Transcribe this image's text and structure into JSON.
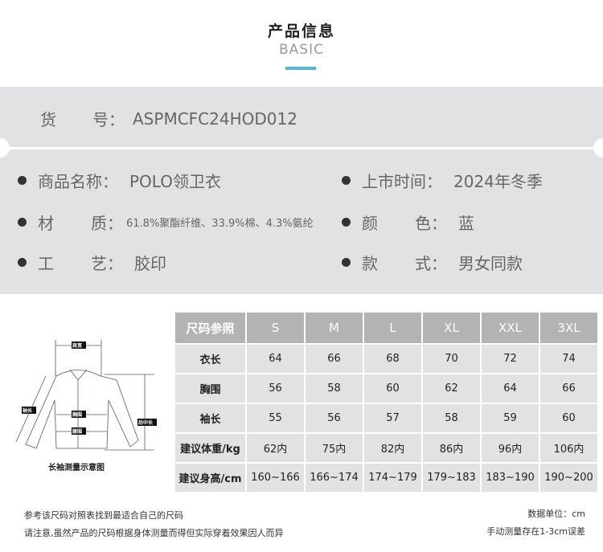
{
  "header": {
    "title": "产品信息",
    "subtitle": "BASIC",
    "accent": "#5bb5d9"
  },
  "info": {
    "sku": {
      "label_a": "货",
      "label_b": "号：",
      "value": "ASPMCFC24HOD012"
    },
    "left": [
      {
        "label_a": "商品名称：",
        "label_b": "",
        "value": "POLO领卫衣"
      },
      {
        "label_a": "材",
        "label_b": "质：",
        "value": "61.8%聚酯纤维、33.9%棉、4.3%氨纶"
      },
      {
        "label_a": "工",
        "label_b": "艺：",
        "value": "胶印"
      }
    ],
    "right": [
      {
        "label_a": "上市时间：",
        "label_b": "",
        "value": "2024年冬季"
      },
      {
        "label_a": "颜",
        "label_b": "色：",
        "value": "蓝"
      },
      {
        "label_a": "款",
        "label_b": "式：",
        "value": "男女同款"
      }
    ]
  },
  "diagram": {
    "caption": "长袖测量示意图",
    "labels": {
      "shoulder": "肩宽",
      "chest": "胸围",
      "waist": "腰围",
      "sleeve": "袖长",
      "back": "后中长"
    }
  },
  "table": {
    "headers": [
      "尺码参照",
      "S",
      "M",
      "L",
      "XL",
      "XXL",
      "3XL"
    ],
    "rows": [
      [
        "衣长",
        "64",
        "66",
        "68",
        "70",
        "72",
        "74"
      ],
      [
        "胸围",
        "56",
        "58",
        "60",
        "62",
        "64",
        "66"
      ],
      [
        "袖长",
        "55",
        "56",
        "57",
        "58",
        "59",
        "60"
      ],
      [
        "建议体重/kg",
        "62内",
        "75内",
        "82内",
        "86内",
        "96内",
        "106内"
      ],
      [
        "建议身高/cm",
        "160~166",
        "166~174",
        "174~179",
        "179~183",
        "183~190",
        "190~200"
      ]
    ]
  },
  "notes": {
    "left1": "参考该尺码对照表找到最适合自己的尺码",
    "left2": "请注意,虽然产品的尺码根据身体测量而得但实际穿着效果因人而异",
    "right1": "数据单位：cm",
    "right2": "手动测量存在1-3cm误差"
  }
}
